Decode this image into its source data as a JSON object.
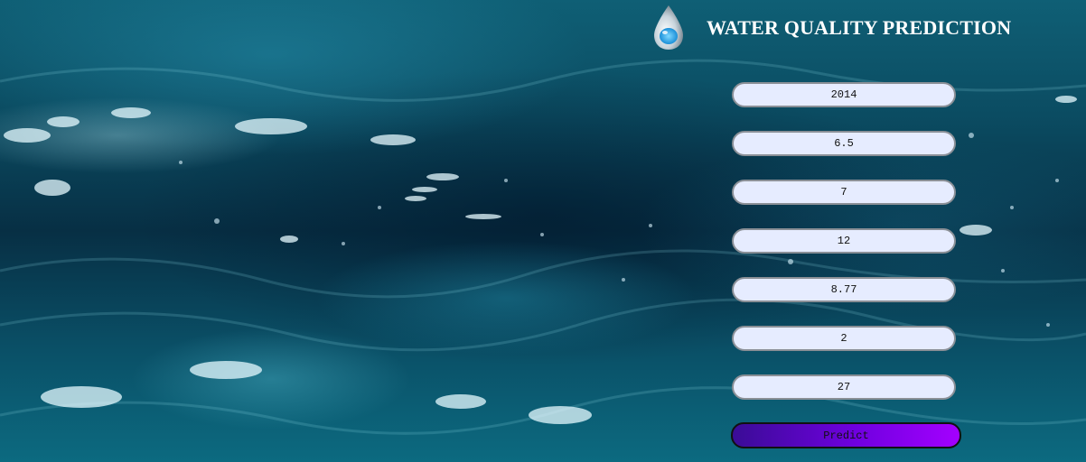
{
  "header": {
    "title": "WATER QUALITY PREDICTION",
    "logo_icon": "water-drop-icon"
  },
  "form": {
    "fields": [
      {
        "value": "2014"
      },
      {
        "value": "6.5"
      },
      {
        "value": "7"
      },
      {
        "value": "12"
      },
      {
        "value": "8.77"
      },
      {
        "value": "2"
      },
      {
        "value": "27"
      }
    ],
    "predict_label": "Predict"
  },
  "colors": {
    "field_background": "#e6ecff",
    "button_gradient_start": "#3a0c96",
    "button_gradient_end": "#a400ff",
    "title_color": "#ffffff"
  }
}
